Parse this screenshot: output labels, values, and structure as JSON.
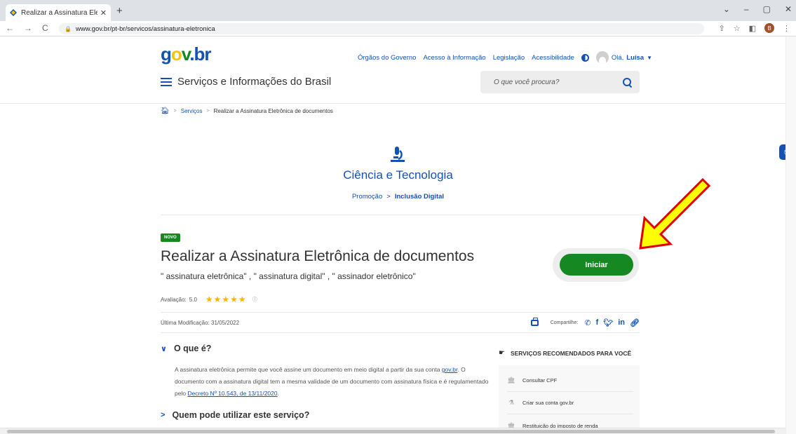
{
  "browser": {
    "tab_title": "Realizar a Assinatura Eletrônica c",
    "tab_close": "✕",
    "new_tab": "+",
    "url": "www.gov.br/pt-br/servicos/assinatura-eletronica",
    "back": "←",
    "forward": "→",
    "reload": "C",
    "profile_initial": "B",
    "win_min": "–",
    "win_max": "▢",
    "win_close": "✕",
    "win_down": "⌄"
  },
  "header": {
    "logo": {
      "g": "g",
      "o": "o",
      "v": "v",
      "dot": ".",
      "br": "br"
    },
    "links": [
      "Órgãos do Governo",
      "Acesso à Informação",
      "Legislação",
      "Acessibilidade"
    ],
    "user_greeting": "Olá,",
    "user_name": "Luísa",
    "menu_label": "Serviços e Informações do Brasil",
    "search_placeholder": "O que você procura?"
  },
  "breadcrumb": {
    "sep": ">",
    "items": [
      "Serviços",
      "Realizar a Assinatura Eletrônica de documentos"
    ]
  },
  "category": {
    "title": "Ciência e Tecnologia",
    "sub_link": "Promoção",
    "sub_sep": ">",
    "sub_current": "Inclusão Digital"
  },
  "service": {
    "badge": "NOVO",
    "title": "Realizar a Assinatura Eletrônica de documentos",
    "tags": "\" assinatura eletrônica\" , \" assinatura digital\" , \" assinador eletrônico\"",
    "rating_label": "Avaliação:",
    "rating_value": "5.0",
    "stars": "★★★★★",
    "info": "ⓘ",
    "start_button": "Iniciar",
    "modified": "Última Modificação: 31/05/2022",
    "share_label": "Compartilhe:"
  },
  "sections": {
    "what_title": "O que é?",
    "what_text_1": "A assinatura eletrônica permite que você assine um documento em meio digital a partir da sua conta ",
    "what_link_1": "gov.br",
    "what_text_2": ". O documento com a assinatura digital tem a mesma validade de um documento com assinatura física e é regulamentado pelo ",
    "what_link_2": "Decreto Nº 10.543, de 13/11/2020",
    "what_text_3": ".",
    "who_title": "Quem pode utilizar este serviço?"
  },
  "recommended": {
    "title": "SERVIÇOS RECOMENDADOS PARA VOCÊ",
    "items": [
      {
        "label": "Consultar CPF"
      },
      {
        "label": "Criar sua conta gov.br"
      },
      {
        "label": "Restituição do imposto de renda"
      }
    ]
  },
  "colors": {
    "primary": "#1351b4",
    "success": "#168821",
    "star": "#f8b500",
    "arrow_fill": "#ffff00",
    "arrow_stroke": "#e00000"
  }
}
